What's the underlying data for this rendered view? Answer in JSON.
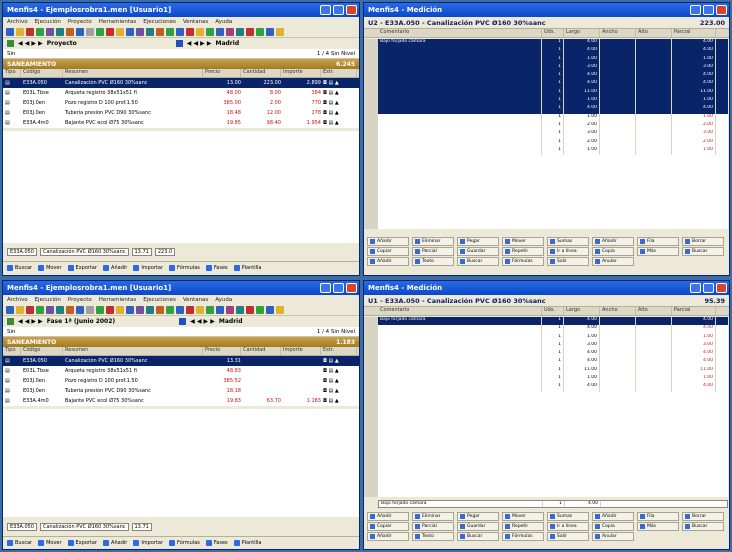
{
  "windows": {
    "top_left": {
      "title": "Menfis4 - Ejemplosrobra1.men [Usuario1]",
      "menus": [
        "Archivo",
        "Ejecución",
        "Proyecto",
        "Herramientas",
        "Ejecuciones",
        "Ventanas",
        "Ayuda"
      ],
      "nav_left": "Proyecto",
      "nav_right": "Madrid",
      "path": "Sin",
      "path_right": "1 / 4 Sin Nivel",
      "section": "SANEAMIENTO",
      "section_total": "6.245",
      "columns": [
        "Tipo",
        "Código",
        "Resumen",
        "Precio",
        "Cantidad",
        "Importe",
        "Estr."
      ],
      "rows": [
        {
          "code": "E33A.050",
          "summary": "Canalización PVC Ø160 30%sanc",
          "price": "13.00",
          "qty": "223.00",
          "amount": "2.899",
          "selected": true
        },
        {
          "code": "E03L.Tbse",
          "summary": "Arqueta registro 38x51x51 fi",
          "price": "48.00",
          "qty": "8.00",
          "amount": "384",
          "selected": false
        },
        {
          "code": "E03J.0en",
          "summary": "Pozo registro D 100 prof.1.50",
          "price": "385.00",
          "qty": "2.00",
          "amount": "770",
          "selected": false
        },
        {
          "code": "E03J.0en",
          "summary": "Tubería presión PVC D90 30%sanc",
          "price": "18.48",
          "qty": "12.00",
          "amount": "178",
          "selected": false
        },
        {
          "code": "E33A.4m0",
          "summary": "Bajante PVC ecol Ø75 30%sanc",
          "price": "19.85",
          "qty": "98.40",
          "amount": "1.954",
          "selected": false
        }
      ],
      "status_code": "E33A.050",
      "status_summary": "Canalización PVC Ø160 30%sanc",
      "status_price": "13.71",
      "status_qty": "223.0",
      "bottom": [
        "Buscar",
        "Mover",
        "Exportar",
        "Añadir",
        "Importar",
        "Fórmulas",
        "Fases",
        "Plantilla"
      ]
    },
    "bottom_left": {
      "title": "Menfis4 - Ejemplosrobra1.men [Usuario1]",
      "menus": [
        "Archivo",
        "Ejecución",
        "Proyecto",
        "Herramientas",
        "Ejecuciones",
        "Ventanas",
        "Ayuda"
      ],
      "nav_left": "Fase 1ª (Junio 2002)",
      "nav_right": "Madrid",
      "path": "Sin",
      "path_right": "1 / 4 Sin Nivel",
      "section": "SANEAMIENTO",
      "section_total": "1.183",
      "columns": [
        "Tipo",
        "Código",
        "Resumen",
        "Precio",
        "Cantidad",
        "Importe",
        "Estr."
      ],
      "rows": [
        {
          "code": "E33A.050",
          "summary": "Canalización PVC Ø160 30%sanc",
          "price": "13.31",
          "qty": "",
          "amount": "",
          "selected": true
        },
        {
          "code": "E03L.Tbse",
          "summary": "Arqueta registro 38x51x51 fi",
          "price": "48.83",
          "qty": "",
          "amount": "",
          "selected": false
        },
        {
          "code": "E03J.0en",
          "summary": "Pozo registro D 100 prof.1.50",
          "price": "385.52",
          "qty": "",
          "amount": "",
          "selected": false
        },
        {
          "code": "E03J.0en",
          "summary": "Tubería presión PVC D90 30%sanc",
          "price": "18.18",
          "qty": "",
          "amount": "",
          "selected": false
        },
        {
          "code": "E33A.4m0",
          "summary": "Bajante PVC ecol Ø75 30%sanc",
          "price": "19.83",
          "qty": "63.70",
          "amount": "1.183",
          "selected": false
        }
      ],
      "status_code": "E33A.050",
      "status_summary": "Canalización PVC Ø160 30%sanc",
      "status_price": "13.71",
      "bottom": [
        "Buscar",
        "Mover",
        "Exportar",
        "Añadir",
        "Importar",
        "Fórmulas",
        "Fases",
        "Plantilla"
      ]
    },
    "top_right": {
      "title": "Menfis4 - Medición",
      "header": "U2 - E33A.050 - Canalización PVC Ø160 30%sanc",
      "header_total": "223.00",
      "columns": [
        "Comentario",
        "Uds.",
        "Largo",
        "Ancho",
        "Alto",
        "Parcial"
      ],
      "rows": [
        {
          "comment": "Bajo forjado cámara",
          "uds": "1",
          "largo": "4.00",
          "parcial": "4.00",
          "selected": true
        },
        {
          "comment": "",
          "uds": "1",
          "largo": "4.00",
          "parcial": "4.00",
          "selected": true
        },
        {
          "comment": "",
          "uds": "1",
          "largo": "1.00",
          "parcial": "1.00",
          "selected": true
        },
        {
          "comment": "",
          "uds": "1",
          "largo": "3.00",
          "parcial": "3.00",
          "selected": true
        },
        {
          "comment": "",
          "uds": "1",
          "largo": "4.00",
          "parcial": "4.00",
          "selected": true
        },
        {
          "comment": "",
          "uds": "1",
          "largo": "4.00",
          "parcial": "4.00",
          "selected": true
        },
        {
          "comment": "",
          "uds": "1",
          "largo": "11.00",
          "parcial": "11.00",
          "selected": true
        },
        {
          "comment": "",
          "uds": "1",
          "largo": "1.00",
          "parcial": "1.00",
          "selected": true
        },
        {
          "comment": "",
          "uds": "1",
          "largo": "4.00",
          "parcial": "4.00",
          "selected": true
        },
        {
          "comment": "",
          "uds": "1",
          "largo": "1.00",
          "parcial": "1.00",
          "selected": false
        },
        {
          "comment": "",
          "uds": "1",
          "largo": "2.00",
          "parcial": "2.00",
          "selected": false
        },
        {
          "comment": "",
          "uds": "1",
          "largo": "3.00",
          "parcial": "3.00",
          "selected": false
        },
        {
          "comment": "",
          "uds": "1",
          "largo": "2.00",
          "parcial": "2.00",
          "selected": false
        },
        {
          "comment": "",
          "uds": "1",
          "largo": "1.00",
          "parcial": "1.00",
          "selected": false
        }
      ],
      "buttons": [
        "Añadir",
        "Eliminar",
        "Pegar",
        "Mover",
        "Sumas",
        "Añadir",
        "Fila",
        "Borrar",
        "Copiar",
        "Parcial",
        "Guardar",
        "Repetir",
        "Ir a línea",
        "Copia",
        "Más",
        "Buscar",
        "Añadir",
        "Texto",
        "Buscar",
        "Fórmulas",
        "Salir",
        "Anular"
      ]
    },
    "bottom_right": {
      "title": "Menfis4 - Medición",
      "header": "U1 - E33A.050 - Canalización PVC Ø160 30%sanc",
      "header_total": "95.39",
      "columns": [
        "Comentario",
        "Uds.",
        "Largo",
        "Ancho",
        "Alto",
        "Parcial"
      ],
      "rows": [
        {
          "comment": "Bajo forjado cámara",
          "uds": "1",
          "largo": "4.00",
          "parcial": "4.00",
          "selected": true
        },
        {
          "comment": "",
          "uds": "1",
          "largo": "4.00",
          "parcial": "4.00",
          "selected": false
        },
        {
          "comment": "",
          "uds": "1",
          "largo": "1.00",
          "parcial": "1.00",
          "selected": false
        },
        {
          "comment": "",
          "uds": "1",
          "largo": "3.00",
          "parcial": "3.00",
          "selected": false
        },
        {
          "comment": "",
          "uds": "1",
          "largo": "4.00",
          "parcial": "4.00",
          "selected": false
        },
        {
          "comment": "",
          "uds": "1",
          "largo": "4.00",
          "parcial": "4.00",
          "selected": false
        },
        {
          "comment": "",
          "uds": "1",
          "largo": "11.00",
          "parcial": "11.00",
          "selected": false
        },
        {
          "comment": "",
          "uds": "1",
          "largo": "1.00",
          "parcial": "1.00",
          "selected": false
        },
        {
          "comment": "",
          "uds": "1",
          "largo": "4.00",
          "parcial": "4.00",
          "selected": false
        }
      ],
      "footer_comment": "Bajo forjado cámara",
      "footer_uds": "1",
      "footer_largo": "4.00",
      "buttons": [
        "Añadir",
        "Eliminar",
        "Pegar",
        "Mover",
        "Sumas",
        "Añadir",
        "Fila",
        "Borrar",
        "Copiar",
        "Parcial",
        "Guardar",
        "Repetir",
        "Ir a línea",
        "Copia",
        "Más",
        "Buscar",
        "Añadir",
        "Texto",
        "Buscar",
        "Fórmulas",
        "Salir",
        "Anular"
      ]
    }
  }
}
